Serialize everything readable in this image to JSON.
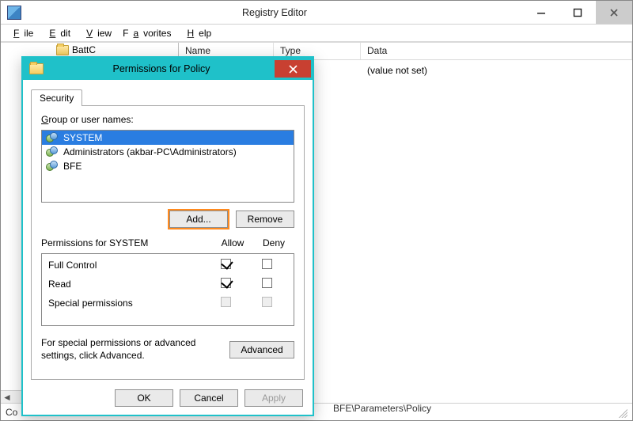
{
  "main_window": {
    "title": "Registry Editor",
    "menu": {
      "file": "File",
      "edit": "Edit",
      "view": "View",
      "favorites": "Favorites",
      "help": "Help"
    },
    "tree": {
      "visible_item": "BattC"
    },
    "list": {
      "columns": {
        "name": "Name",
        "type": "Type",
        "data": "Data"
      },
      "rows": [
        {
          "data": "(value not set)"
        }
      ]
    },
    "statusbar": {
      "path_prefix": "Co",
      "path_visible": "BFE\\Parameters\\Policy"
    }
  },
  "dialog": {
    "title": "Permissions for Policy",
    "tab_security": "Security",
    "group_label": "Group or user names:",
    "users": [
      {
        "name": "SYSTEM",
        "selected": true
      },
      {
        "name": "Administrators (akbar-PC\\Administrators)",
        "selected": false
      },
      {
        "name": "BFE",
        "selected": false
      }
    ],
    "buttons": {
      "add": "Add...",
      "remove": "Remove",
      "advanced": "Advanced",
      "ok": "OK",
      "cancel": "Cancel",
      "apply": "Apply"
    },
    "perm_header": {
      "for": "Permissions for SYSTEM",
      "allow": "Allow",
      "deny": "Deny"
    },
    "permissions": [
      {
        "label": "Full Control",
        "allow": true,
        "deny": false,
        "disabled": false
      },
      {
        "label": "Read",
        "allow": true,
        "deny": false,
        "disabled": false
      },
      {
        "label": "Special permissions",
        "allow": false,
        "deny": false,
        "disabled": true
      }
    ],
    "adv_text": "For special permissions or advanced settings, click Advanced."
  }
}
